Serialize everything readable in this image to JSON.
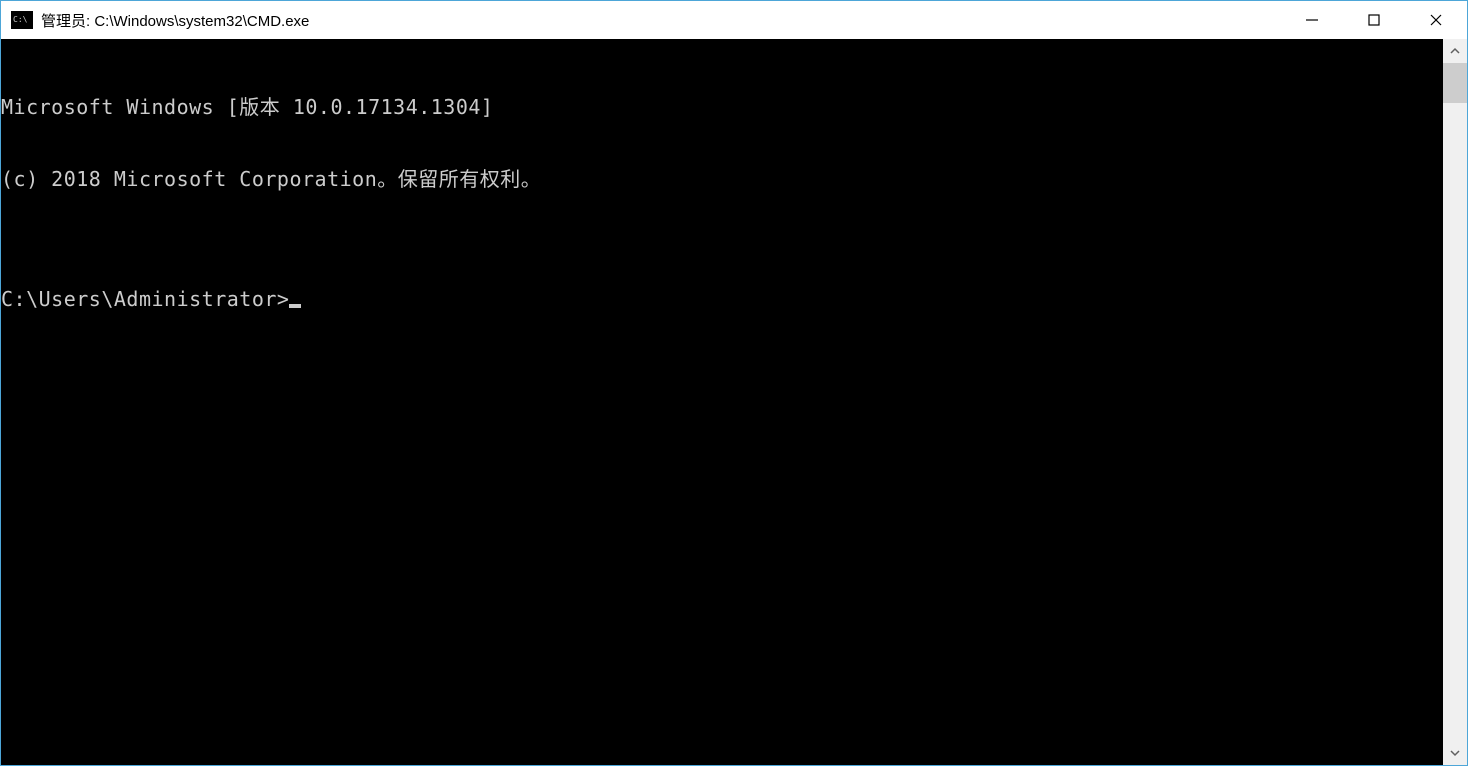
{
  "window": {
    "title": "管理员: C:\\Windows\\system32\\CMD.exe"
  },
  "terminal": {
    "line1": "Microsoft Windows [版本 10.0.17134.1304]",
    "line2": "(c) 2018 Microsoft Corporation。保留所有权利。",
    "blank": "",
    "prompt": "C:\\Users\\Administrator>"
  }
}
